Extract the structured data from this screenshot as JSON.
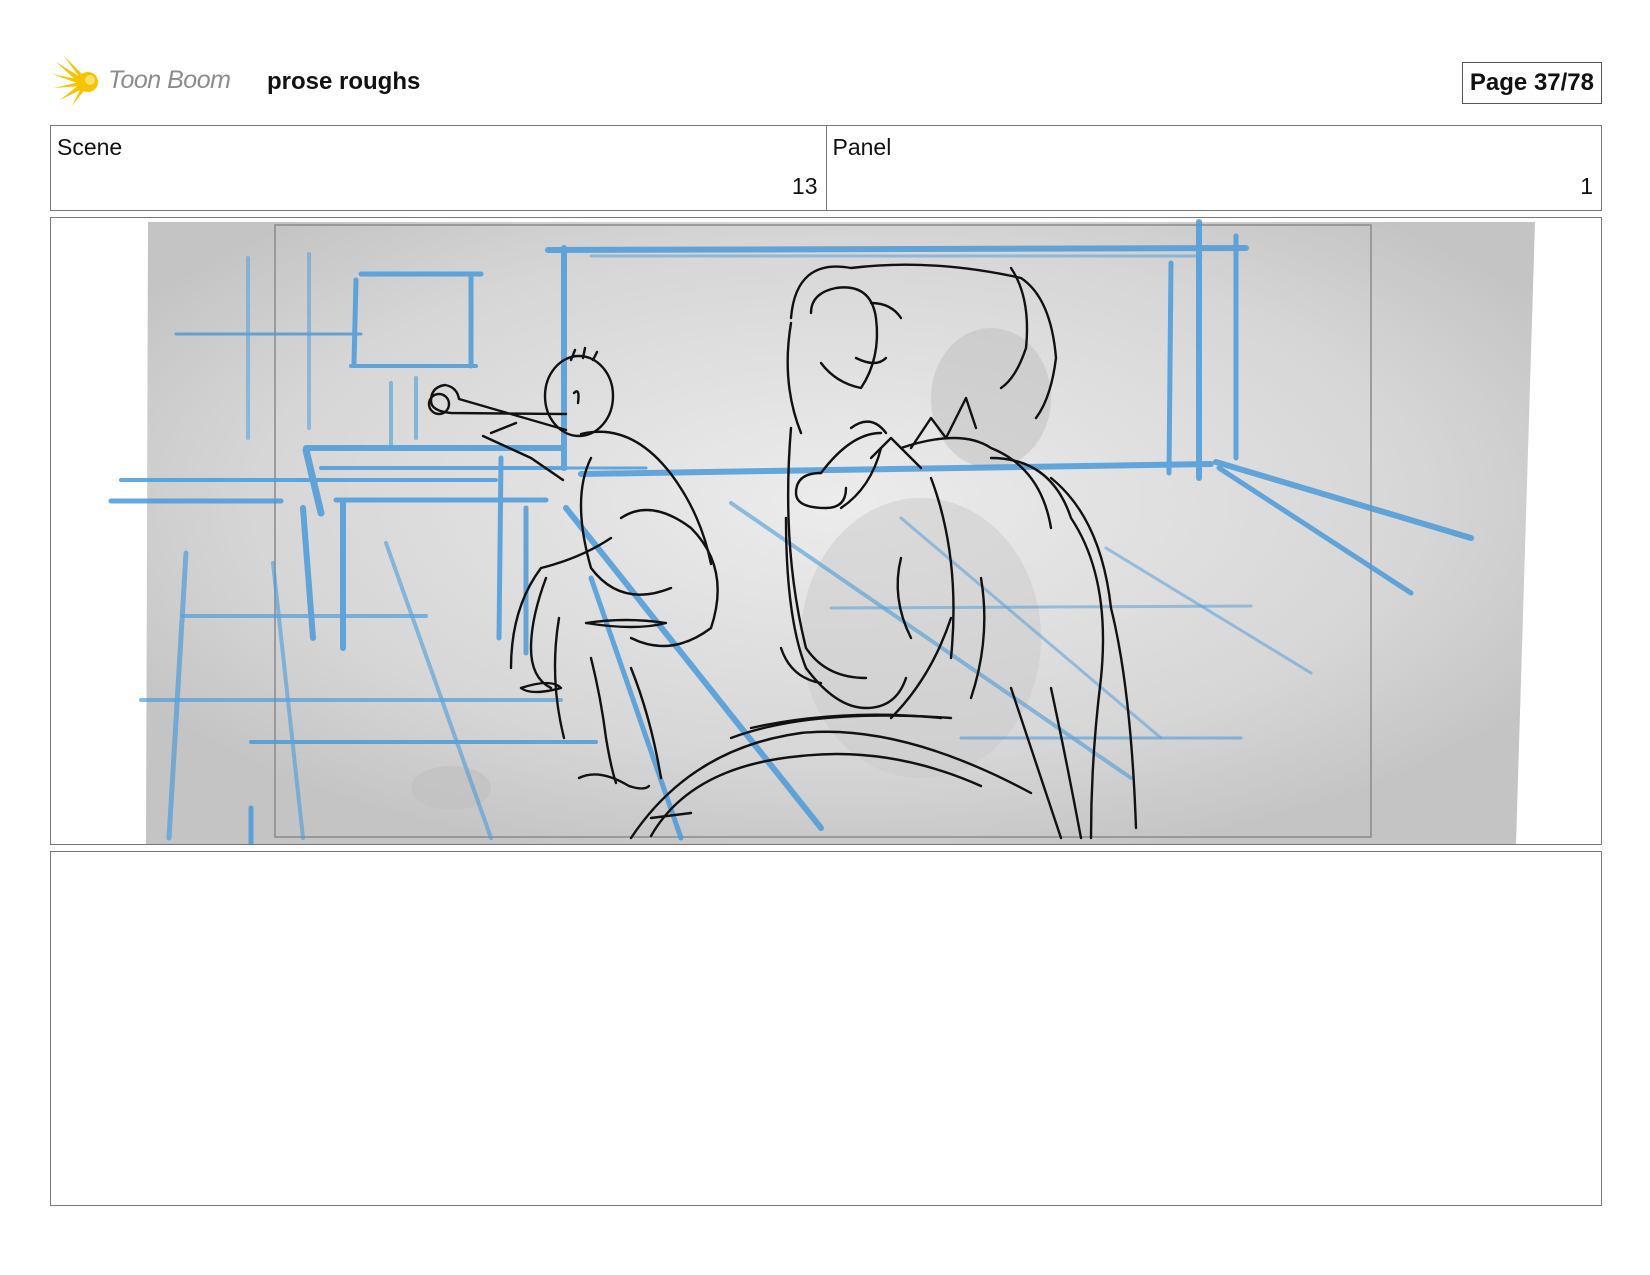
{
  "header": {
    "logo_text": "Toon Boom",
    "project_title": "prose roughs",
    "page_label": "Page 37/78"
  },
  "info": {
    "scene_label": "Scene",
    "scene_value": "13",
    "panel_label": "Panel",
    "panel_value": "1"
  },
  "notes": {
    "text": ""
  },
  "colors": {
    "guide_line": "#4a9ad8",
    "sketch_line": "#111111",
    "canvas_bg": "#cfcfcf"
  }
}
